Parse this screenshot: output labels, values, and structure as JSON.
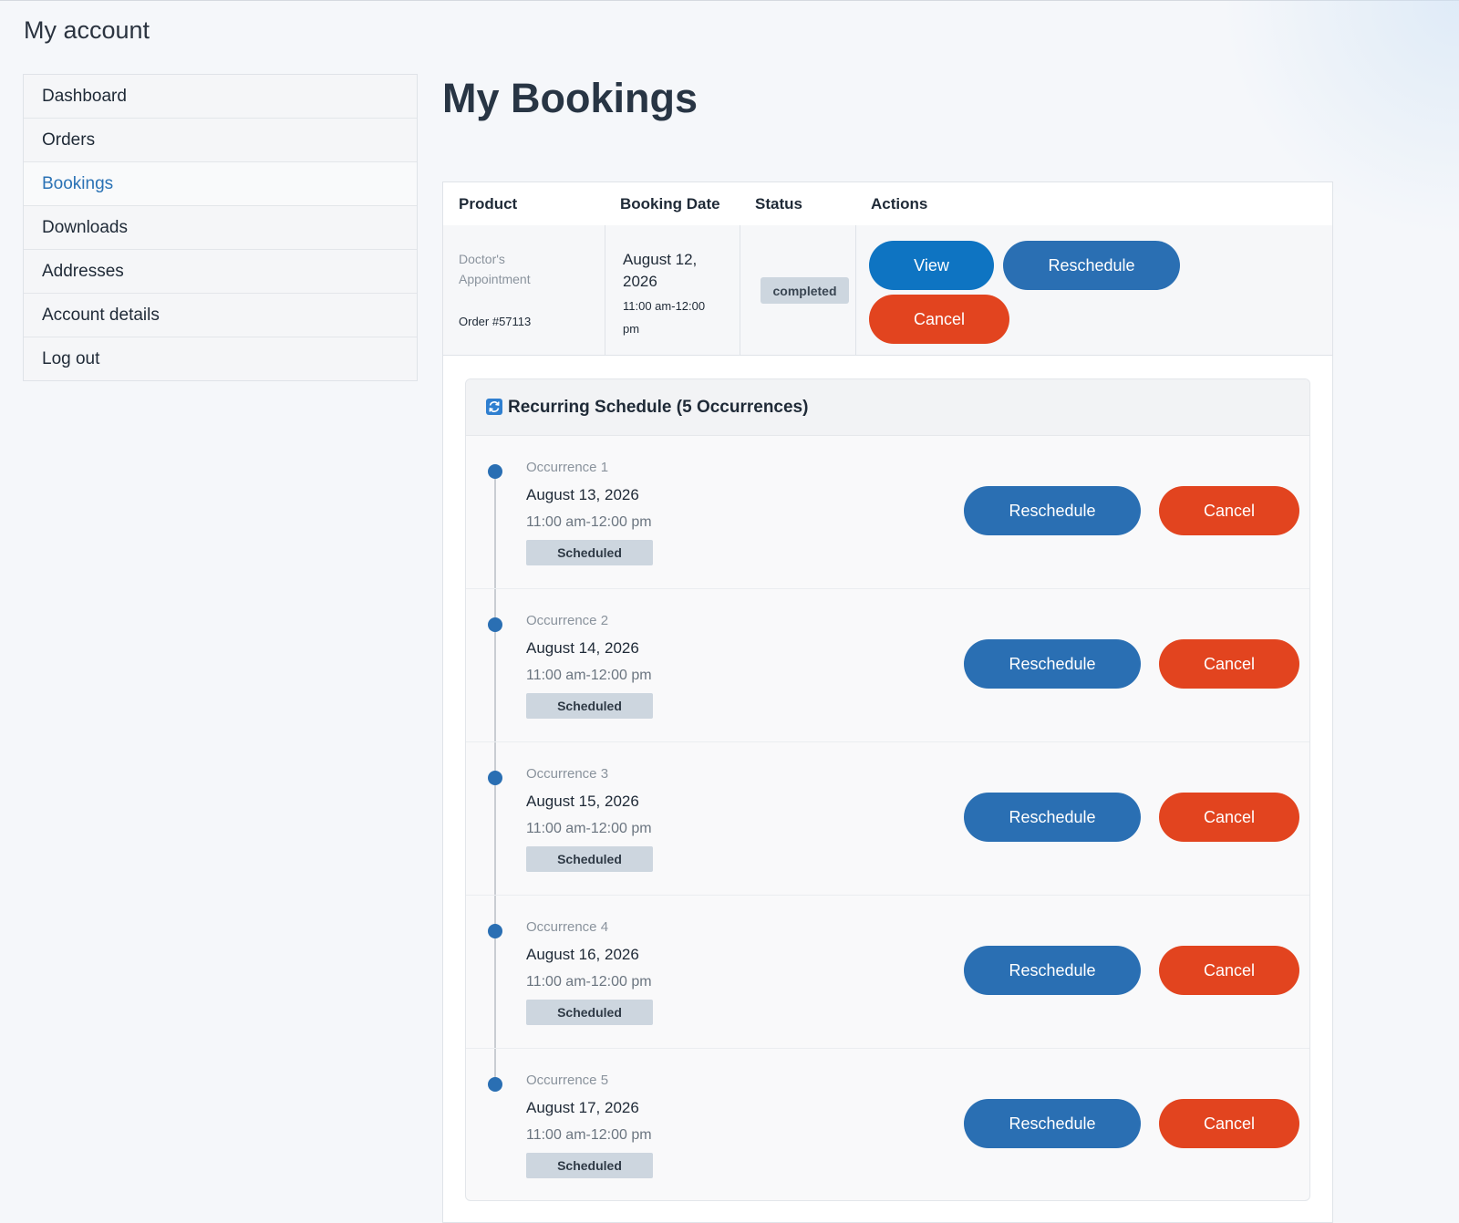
{
  "page": {
    "account_title": "My account",
    "heading": "My Bookings"
  },
  "sidebar": {
    "items": [
      {
        "label": "Dashboard"
      },
      {
        "label": "Orders"
      },
      {
        "label": "Bookings",
        "active": true
      },
      {
        "label": "Downloads"
      },
      {
        "label": "Addresses"
      },
      {
        "label": "Account details"
      },
      {
        "label": "Log out"
      }
    ]
  },
  "table": {
    "headers": {
      "product": "Product",
      "booking_date": "Booking Date",
      "status": "Status",
      "actions": "Actions"
    },
    "row": {
      "product": "Doctor's Appointment",
      "order": "Order #57113",
      "date": "August 12, 2026",
      "time": "11:00 am-12:00 pm",
      "status": "completed",
      "actions": {
        "view": "View",
        "reschedule": "Reschedule",
        "cancel": "Cancel"
      }
    }
  },
  "recurring": {
    "title": "Recurring Schedule (5 Occurrences)",
    "icon": "recurring-icon",
    "occurrences": [
      {
        "label": "Occurrence 1",
        "date": "August 13, 2026",
        "time": "11:00 am-12:00 pm",
        "status": "Scheduled",
        "reschedule": "Reschedule",
        "cancel": "Cancel"
      },
      {
        "label": "Occurrence 2",
        "date": "August 14, 2026",
        "time": "11:00 am-12:00 pm",
        "status": "Scheduled",
        "reschedule": "Reschedule",
        "cancel": "Cancel"
      },
      {
        "label": "Occurrence 3",
        "date": "August 15, 2026",
        "time": "11:00 am-12:00 pm",
        "status": "Scheduled",
        "reschedule": "Reschedule",
        "cancel": "Cancel"
      },
      {
        "label": "Occurrence 4",
        "date": "August 16, 2026",
        "time": "11:00 am-12:00 pm",
        "status": "Scheduled",
        "reschedule": "Reschedule",
        "cancel": "Cancel"
      },
      {
        "label": "Occurrence 5",
        "date": "August 17, 2026",
        "time": "11:00 am-12:00 pm",
        "status": "Scheduled",
        "reschedule": "Reschedule",
        "cancel": "Cancel"
      }
    ]
  },
  "colors": {
    "primary": "#2a6fb3",
    "view": "#0e74c2",
    "danger": "#e2441f",
    "link_active": "#2a72b5",
    "badge": "#cdd6df"
  }
}
